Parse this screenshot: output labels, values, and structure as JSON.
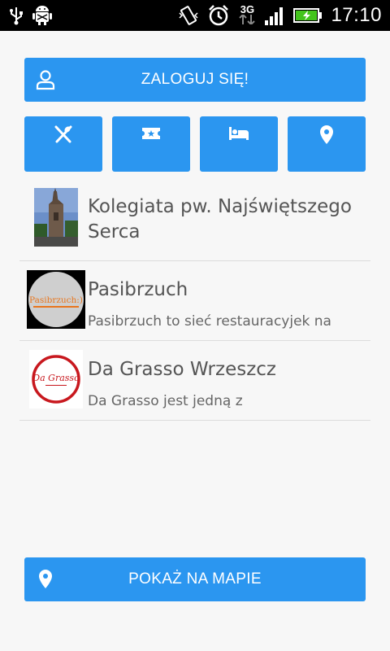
{
  "status_bar": {
    "network": "3G",
    "time": "17:10",
    "icons": [
      "usb-icon",
      "android-debug-icon",
      "vibrate-icon",
      "alarm-icon",
      "signal-icon",
      "battery-charging-icon"
    ]
  },
  "login_button": {
    "label": "ZALOGUJ SIĘ!",
    "icon": "user-icon"
  },
  "categories": [
    {
      "icon": "fork-knife-icon"
    },
    {
      "icon": "ticket-icon"
    },
    {
      "icon": "bed-icon"
    },
    {
      "icon": "map-pin-icon"
    }
  ],
  "places": [
    {
      "title": "Kolegiata pw. Najświętszego Serca",
      "description": ""
    },
    {
      "title": "Pasibrzuch",
      "description": "Pasibrzuch to sieć restauracyjek na",
      "logo_text": "Pasibrzuch:)"
    },
    {
      "title": "Da Grasso Wrzeszcz",
      "description": "Da Grasso jest jedną z",
      "logo_text": "Da Grasso"
    }
  ],
  "map_button": {
    "label": "POKAŻ NA MAPIE",
    "icon": "map-pin-icon"
  },
  "colors": {
    "accent": "#2b96f0",
    "background": "#f7f7f7",
    "status_bar": "#000000"
  }
}
